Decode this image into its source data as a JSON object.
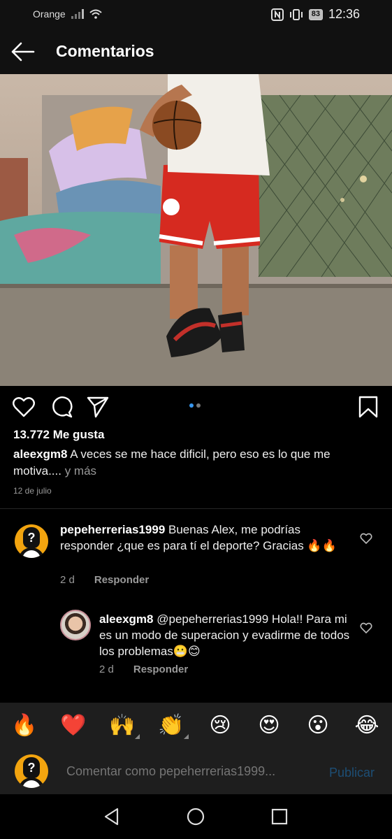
{
  "status": {
    "carrier": "Orange",
    "battery": "83",
    "time": "12:36"
  },
  "header": {
    "title": "Comentarios"
  },
  "post": {
    "likes": "13.772 Me gusta",
    "author": "aleexgm8",
    "caption": "A veces se me hace dificil, pero eso es lo que me motiva....",
    "more": "y más",
    "date": "12 de julio",
    "carousel_active": 1,
    "carousel_total": 2
  },
  "comments": [
    {
      "user": "pepeherrerias1999",
      "text": "Buenas Alex, me podrías responder ¿que es para tí el deporte? Gracias 🔥🔥",
      "age": "2 d",
      "reply_label": "Responder"
    },
    {
      "user": "aleexgm8",
      "text": "@pepeherrerias1999 Hola!! Para mi es un modo de superacion y evadirme de todos los problemas😬😊",
      "age": "2 d",
      "reply_label": "Responder"
    }
  ],
  "emojis": [
    "🔥",
    "❤️",
    "🙌",
    "👏",
    "😢",
    "😍",
    "😮",
    "😂"
  ],
  "composer": {
    "placeholder": "Comentar como pepeherrerias1999...",
    "publish_label": "Publicar"
  },
  "colors": {
    "accent_dot": "#3897f0",
    "publish_disabled": "#1d4e75",
    "avatar_bg": "#f2a40f"
  }
}
